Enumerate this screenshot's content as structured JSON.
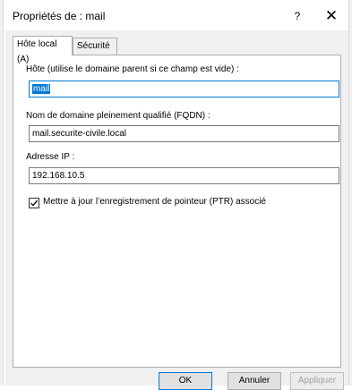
{
  "window": {
    "title": "Propriétés de : mail",
    "help_glyph": "?",
    "close_glyph": "✕"
  },
  "tabs": [
    {
      "label": "Hôte local (A)",
      "active": true
    },
    {
      "label": "Sécurité",
      "active": false
    }
  ],
  "form": {
    "host_label": "Hôte (utilise le domaine parent si ce champ est vide) :",
    "host_value": "mail",
    "fqdn_label": "Nom de domaine pleinement qualifié (FQDN) :",
    "fqdn_value": "mail.securite-civile.local",
    "ip_label": "Adresse IP :",
    "ip_value": "192.168.10.5",
    "ptr_checkbox_label": "Mettre à jour l’enregistrement de pointeur (PTR) associé",
    "ptr_checked": true
  },
  "buttons": {
    "ok": "OK",
    "cancel": "Annuler",
    "apply": "Appliquer"
  },
  "colors": {
    "accent": "#0078d7",
    "dialog_bg": "#f0f0f0",
    "panel_bg": "#ffffff"
  }
}
